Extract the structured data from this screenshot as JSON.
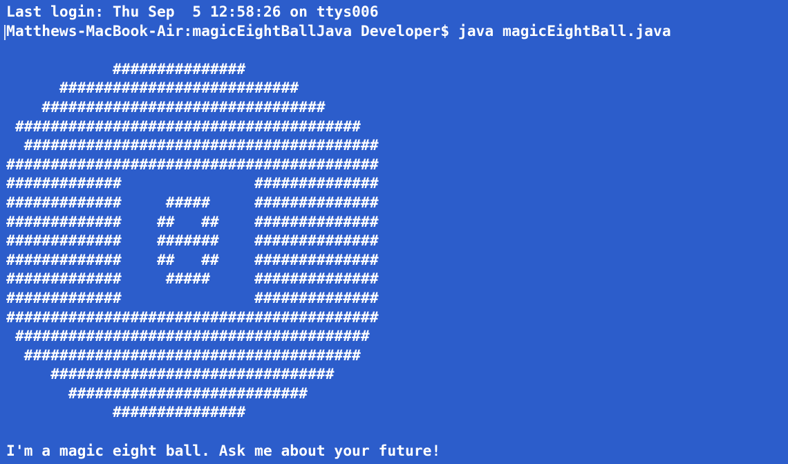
{
  "terminal": {
    "last_login": "Last login: Thu Sep  5 12:58:26 on ttys006",
    "prompt_command": "Matthews-MacBook-Air:magicEightBallJava Developer$ java magicEightBall.java",
    "ascii_art": [
      "",
      "            ###############",
      "      ###########################",
      "    ################################",
      " #######################################",
      "  ########################################",
      "##########################################",
      "#############               ##############",
      "#############     #####     ##############",
      "#############    ##   ##    ##############",
      "#############    #######    ##############",
      "#############    ##   ##    ##############",
      "#############     #####     ##############",
      "#############               ##############",
      "##########################################",
      " ########################################",
      "  ######################################",
      "     ################################",
      "       ###########################",
      "            ###############",
      ""
    ],
    "output_message": "I'm a magic eight ball. Ask me about your future!"
  }
}
